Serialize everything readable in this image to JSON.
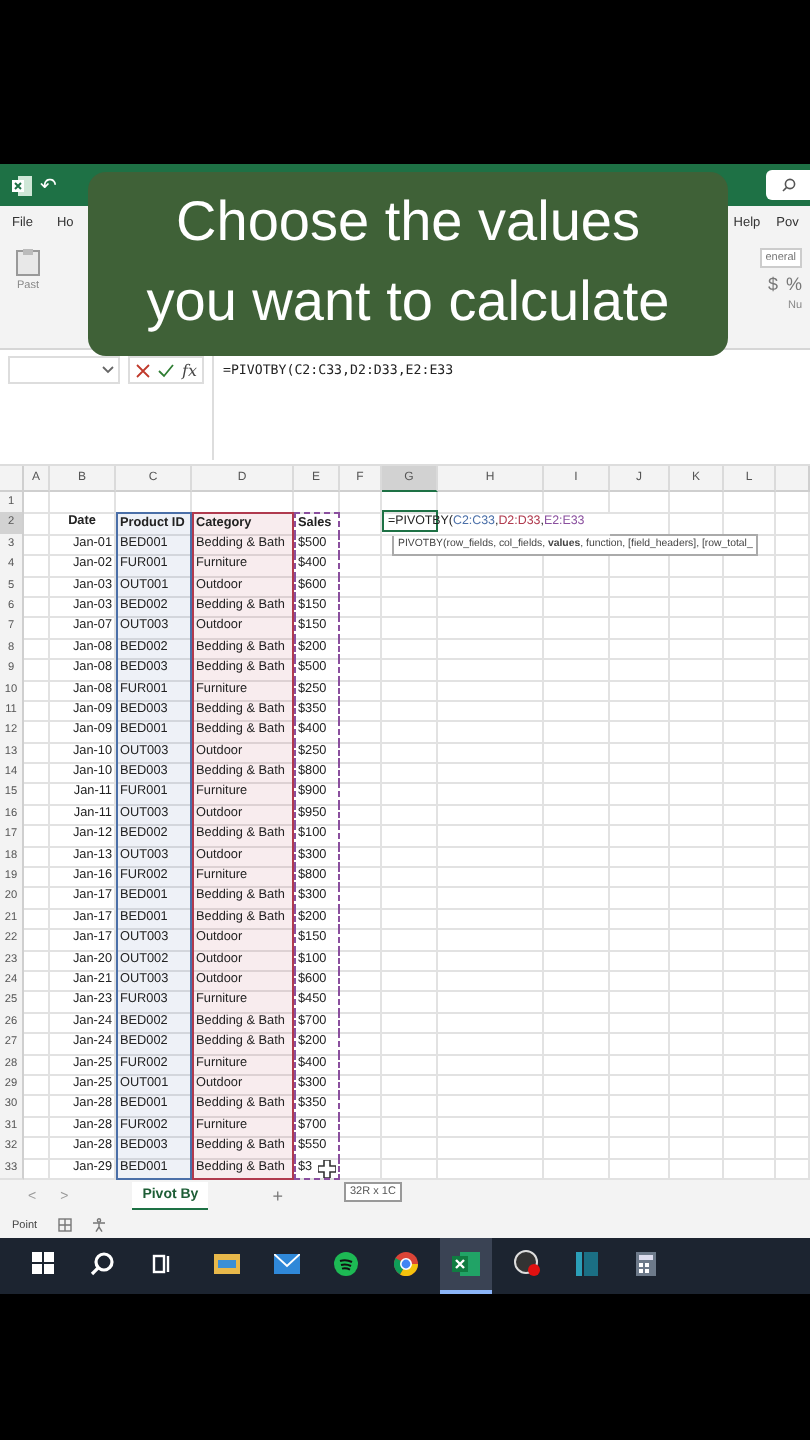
{
  "title_bar": {
    "undo": "↶"
  },
  "ribbon_tabs": [
    "File",
    "Ho",
    "Help",
    "Pov"
  ],
  "ribbon": {
    "paste_label": "Past",
    "format_box": "eneral",
    "currency": "$",
    "percent": "%",
    "group_label": "Nu"
  },
  "caption": {
    "lines": [
      "Choose the values",
      "you want to calculate"
    ]
  },
  "formula_bar": {
    "fx_label": "fx",
    "formula": "=PIVOTBY(C2:C33,D2:D33,E2:E33"
  },
  "sheet": {
    "columns": [
      {
        "label": "A",
        "selected": false
      },
      {
        "label": "B",
        "selected": false
      },
      {
        "label": "C",
        "selected": false
      },
      {
        "label": "D",
        "selected": false
      },
      {
        "label": "E",
        "selected": false
      },
      {
        "label": "F",
        "selected": false
      },
      {
        "label": "G",
        "selected": true
      },
      {
        "label": "H",
        "selected": false
      },
      {
        "label": "I",
        "selected": false
      },
      {
        "label": "J",
        "selected": false
      },
      {
        "label": "K",
        "selected": false
      },
      {
        "label": "L",
        "selected": false
      }
    ],
    "rows": [
      [
        "",
        "Date",
        "Product ID",
        "Category",
        "Sales"
      ],
      [
        "",
        "Jan-01",
        "BED001",
        "Bedding & Bath",
        "$500"
      ],
      [
        "",
        "Jan-02",
        "FUR001",
        "Furniture",
        "$400"
      ],
      [
        "",
        "Jan-03",
        "OUT001",
        "Outdoor",
        "$600"
      ],
      [
        "",
        "Jan-03",
        "BED002",
        "Bedding & Bath",
        "$150"
      ],
      [
        "",
        "Jan-07",
        "OUT003",
        "Outdoor",
        "$150"
      ],
      [
        "",
        "Jan-08",
        "BED002",
        "Bedding & Bath",
        "$200"
      ],
      [
        "",
        "Jan-08",
        "BED003",
        "Bedding & Bath",
        "$500"
      ],
      [
        "",
        "Jan-08",
        "FUR001",
        "Furniture",
        "$250"
      ],
      [
        "",
        "Jan-09",
        "BED003",
        "Bedding & Bath",
        "$350"
      ],
      [
        "",
        "Jan-09",
        "BED001",
        "Bedding & Bath",
        "$400"
      ],
      [
        "",
        "Jan-10",
        "OUT003",
        "Outdoor",
        "$250"
      ],
      [
        "",
        "Jan-10",
        "BED003",
        "Bedding & Bath",
        "$800"
      ],
      [
        "",
        "Jan-11",
        "FUR001",
        "Furniture",
        "$900"
      ],
      [
        "",
        "Jan-11",
        "OUT003",
        "Outdoor",
        "$950"
      ],
      [
        "",
        "Jan-12",
        "BED002",
        "Bedding & Bath",
        "$100"
      ],
      [
        "",
        "Jan-13",
        "OUT003",
        "Outdoor",
        "$300"
      ],
      [
        "",
        "Jan-16",
        "FUR002",
        "Furniture",
        "$800"
      ],
      [
        "",
        "Jan-17",
        "BED001",
        "Bedding & Bath",
        "$300"
      ],
      [
        "",
        "Jan-17",
        "BED001",
        "Bedding & Bath",
        "$200"
      ],
      [
        "",
        "Jan-17",
        "OUT003",
        "Outdoor",
        "$150"
      ],
      [
        "",
        "Jan-20",
        "OUT002",
        "Outdoor",
        "$100"
      ],
      [
        "",
        "Jan-21",
        "OUT003",
        "Outdoor",
        "$600"
      ],
      [
        "",
        "Jan-23",
        "FUR003",
        "Furniture",
        "$450"
      ],
      [
        "",
        "Jan-24",
        "BED002",
        "Bedding & Bath",
        "$700"
      ],
      [
        "",
        "Jan-24",
        "BED002",
        "Bedding & Bath",
        "$200"
      ],
      [
        "",
        "Jan-25",
        "FUR002",
        "Furniture",
        "$400"
      ],
      [
        "",
        "Jan-25",
        "OUT001",
        "Outdoor",
        "$300"
      ],
      [
        "",
        "Jan-28",
        "BED001",
        "Bedding & Bath",
        "$350"
      ],
      [
        "",
        "Jan-28",
        "FUR002",
        "Furniture",
        "$700"
      ],
      [
        "",
        "Jan-28",
        "BED003",
        "Bedding & Bath",
        "$550"
      ],
      [
        "",
        "Jan-29",
        "BED001",
        "Bedding & Bath",
        "$3"
      ]
    ],
    "row_numbers": [
      {
        "label": "1",
        "selected": false
      },
      {
        "label": "2",
        "selected": true
      },
      {
        "label": "3",
        "selected": false
      },
      {
        "label": "4",
        "selected": false
      },
      {
        "label": "5",
        "selected": false
      },
      {
        "label": "6",
        "selected": false
      },
      {
        "label": "7",
        "selected": false
      },
      {
        "label": "8",
        "selected": false
      },
      {
        "label": "9",
        "selected": false
      },
      {
        "label": "10",
        "selected": false
      },
      {
        "label": "11",
        "selected": false
      },
      {
        "label": "12",
        "selected": false
      },
      {
        "label": "13",
        "selected": false
      },
      {
        "label": "14",
        "selected": false
      },
      {
        "label": "15",
        "selected": false
      },
      {
        "label": "16",
        "selected": false
      },
      {
        "label": "17",
        "selected": false
      },
      {
        "label": "18",
        "selected": false
      },
      {
        "label": "19",
        "selected": false
      },
      {
        "label": "20",
        "selected": false
      },
      {
        "label": "21",
        "selected": false
      },
      {
        "label": "22",
        "selected": false
      },
      {
        "label": "23",
        "selected": false
      },
      {
        "label": "24",
        "selected": false
      },
      {
        "label": "25",
        "selected": false
      },
      {
        "label": "26",
        "selected": false
      },
      {
        "label": "27",
        "selected": false
      },
      {
        "label": "28",
        "selected": false
      },
      {
        "label": "29",
        "selected": false
      },
      {
        "label": "30",
        "selected": false
      },
      {
        "label": "31",
        "selected": false
      },
      {
        "label": "32",
        "selected": false
      },
      {
        "label": "33",
        "selected": false
      }
    ],
    "active_cell": {
      "segments": [
        {
          "kind": "text",
          "text": "=PIVOTBY("
        },
        {
          "kind": "ref",
          "text": "C2:C33",
          "color": "#4a6fa8"
        },
        {
          "kind": "text",
          "text": ","
        },
        {
          "kind": "ref",
          "text": "D2:D33",
          "color": "#b03a4e"
        },
        {
          "kind": "text",
          "text": ","
        },
        {
          "kind": "ref",
          "text": "E2:E33",
          "color": "#8a4f9e"
        }
      ]
    },
    "tooltip": "PIVOTBY(row_fields, col_fields, **values**, function, [field_headers], [row_total_",
    "size_tip": "32R x 1C"
  },
  "sheet_tabs": {
    "prev": "<",
    "next": ">",
    "tabs": [
      {
        "label": "Pivot By",
        "selected": true
      }
    ],
    "add": "+"
  },
  "status_bar": {
    "mode": "Point"
  },
  "taskbar": [
    {
      "kind": "start",
      "selected": false
    },
    {
      "kind": "search",
      "selected": false
    },
    {
      "kind": "taskview",
      "selected": false
    },
    {
      "kind": "folder",
      "selected": false
    },
    {
      "kind": "mail",
      "selected": false
    },
    {
      "kind": "music",
      "selected": false
    },
    {
      "kind": "browser",
      "selected": false
    },
    {
      "kind": "sheet",
      "selected": true
    },
    {
      "kind": "record",
      "selected": false
    },
    {
      "kind": "panel",
      "selected": false
    },
    {
      "kind": "calc",
      "selected": false
    }
  ]
}
